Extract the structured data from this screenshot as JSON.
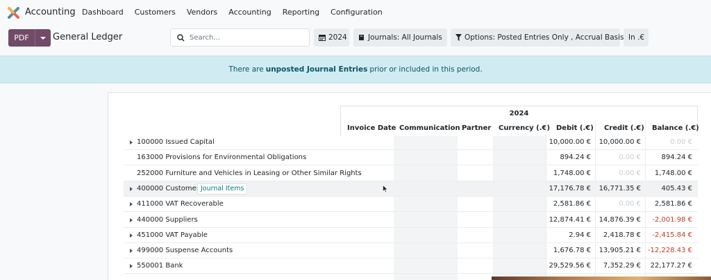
{
  "app": {
    "name": "Accounting",
    "logo_icon": "odoo-accounting-logo"
  },
  "menu": [
    "Dashboard",
    "Customers",
    "Vendors",
    "Accounting",
    "Reporting",
    "Configuration"
  ],
  "toolbar": {
    "pdf_label": "PDF",
    "report_title": "General Ledger",
    "search_placeholder": "Search...",
    "year_filter": "2024",
    "journals_filter": "Journals: All Journals",
    "options_filter": "Options: Posted Entries Only , Accrual Basis",
    "currency_filter": "In .€"
  },
  "banner": {
    "before": "There are",
    "bold": "unposted Journal Entries",
    "after": "prior or included in this period."
  },
  "table": {
    "period": "2024",
    "columns": [
      "Invoice Date",
      "Communication",
      "Partner",
      "Currency (.€)",
      "Debit (.€)",
      "Credit (.€)",
      "Balance (.€)"
    ],
    "rows": [
      {
        "name": "100000 Issued Capital",
        "expandable": true,
        "debit": "10,000.00 €",
        "credit": "10,000.00 €",
        "balance": "0.00 €",
        "credit_zero": false,
        "debit_zero": false,
        "balance_zero": true,
        "balance_negative": false
      },
      {
        "name": "163000 Provisions for Environmental Obligations",
        "expandable": false,
        "debit": "894.24 €",
        "credit": "0.00 €",
        "balance": "894.24 €",
        "credit_zero": true,
        "debit_zero": false,
        "balance_zero": false,
        "balance_negative": false
      },
      {
        "name": "252000 Furniture and Vehicles in Leasing or Other Similar Rights",
        "expandable": false,
        "debit": "1,748.00 €",
        "credit": "0.00 €",
        "balance": "1,748.00 €",
        "credit_zero": true,
        "debit_zero": false,
        "balance_zero": false,
        "balance_negative": false
      },
      {
        "name": "400000 Customers",
        "expandable": true,
        "highlighted": true,
        "action": "Journal Items",
        "debit": "17,176.78 €",
        "credit": "16,771.35 €",
        "balance": "405.43 €",
        "credit_zero": false,
        "debit_zero": false,
        "balance_zero": false,
        "balance_negative": false
      },
      {
        "name": "411000 VAT Recoverable",
        "expandable": true,
        "debit": "2,581.86 €",
        "credit": "0.00 €",
        "balance": "2,581.86 €",
        "credit_zero": true,
        "debit_zero": false,
        "balance_zero": false,
        "balance_negative": false
      },
      {
        "name": "440000 Suppliers",
        "expandable": true,
        "debit": "12,874.41 €",
        "credit": "14,876.39 €",
        "balance": "-2,001.98 €",
        "credit_zero": false,
        "debit_zero": false,
        "balance_zero": false,
        "balance_negative": true
      },
      {
        "name": "451000 VAT Payable",
        "expandable": true,
        "debit": "2.94 €",
        "credit": "2,418.78 €",
        "balance": "-2,415.84 €",
        "credit_zero": false,
        "debit_zero": false,
        "balance_zero": false,
        "balance_negative": true
      },
      {
        "name": "499000 Suspense Accounts",
        "expandable": true,
        "debit": "1,676.78 €",
        "credit": "13,905.21 €",
        "balance": "-12,228.43 €",
        "credit_zero": false,
        "debit_zero": false,
        "balance_zero": false,
        "balance_negative": true
      },
      {
        "name": "550001 Bank",
        "expandable": true,
        "debit": "29,529.56 €",
        "credit": "7,352.29 €",
        "balance": "22,177.27 €",
        "credit_zero": false,
        "debit_zero": false,
        "balance_zero": false,
        "balance_negative": false
      }
    ]
  },
  "colors": {
    "primary": "#714b67",
    "banner_bg": "#d0ecf2",
    "negative": "#c0392b",
    "link": "#017e84"
  }
}
